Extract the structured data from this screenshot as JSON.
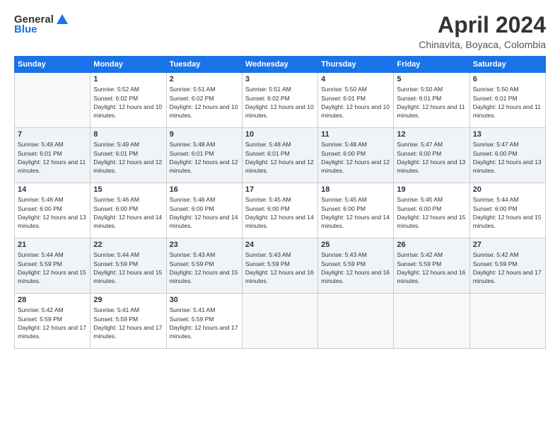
{
  "logo": {
    "general": "General",
    "blue": "Blue"
  },
  "title": "April 2024",
  "location": "Chinavita, Boyaca, Colombia",
  "weekdays": [
    "Sunday",
    "Monday",
    "Tuesday",
    "Wednesday",
    "Thursday",
    "Friday",
    "Saturday"
  ],
  "weeks": [
    [
      {
        "day": "",
        "sunrise": "",
        "sunset": "",
        "daylight": ""
      },
      {
        "day": "1",
        "sunrise": "Sunrise: 5:52 AM",
        "sunset": "Sunset: 6:02 PM",
        "daylight": "Daylight: 12 hours and 10 minutes."
      },
      {
        "day": "2",
        "sunrise": "Sunrise: 5:51 AM",
        "sunset": "Sunset: 6:02 PM",
        "daylight": "Daylight: 12 hours and 10 minutes."
      },
      {
        "day": "3",
        "sunrise": "Sunrise: 5:51 AM",
        "sunset": "Sunset: 6:02 PM",
        "daylight": "Daylight: 12 hours and 10 minutes."
      },
      {
        "day": "4",
        "sunrise": "Sunrise: 5:50 AM",
        "sunset": "Sunset: 6:01 PM",
        "daylight": "Daylight: 12 hours and 10 minutes."
      },
      {
        "day": "5",
        "sunrise": "Sunrise: 5:50 AM",
        "sunset": "Sunset: 6:01 PM",
        "daylight": "Daylight: 12 hours and 11 minutes."
      },
      {
        "day": "6",
        "sunrise": "Sunrise: 5:50 AM",
        "sunset": "Sunset: 6:01 PM",
        "daylight": "Daylight: 12 hours and 11 minutes."
      }
    ],
    [
      {
        "day": "7",
        "sunrise": "Sunrise: 5:49 AM",
        "sunset": "Sunset: 6:01 PM",
        "daylight": "Daylight: 12 hours and 11 minutes."
      },
      {
        "day": "8",
        "sunrise": "Sunrise: 5:49 AM",
        "sunset": "Sunset: 6:01 PM",
        "daylight": "Daylight: 12 hours and 12 minutes."
      },
      {
        "day": "9",
        "sunrise": "Sunrise: 5:48 AM",
        "sunset": "Sunset: 6:01 PM",
        "daylight": "Daylight: 12 hours and 12 minutes."
      },
      {
        "day": "10",
        "sunrise": "Sunrise: 5:48 AM",
        "sunset": "Sunset: 6:01 PM",
        "daylight": "Daylight: 12 hours and 12 minutes."
      },
      {
        "day": "11",
        "sunrise": "Sunrise: 5:48 AM",
        "sunset": "Sunset: 6:00 PM",
        "daylight": "Daylight: 12 hours and 12 minutes."
      },
      {
        "day": "12",
        "sunrise": "Sunrise: 5:47 AM",
        "sunset": "Sunset: 6:00 PM",
        "daylight": "Daylight: 12 hours and 13 minutes."
      },
      {
        "day": "13",
        "sunrise": "Sunrise: 5:47 AM",
        "sunset": "Sunset: 6:00 PM",
        "daylight": "Daylight: 12 hours and 13 minutes."
      }
    ],
    [
      {
        "day": "14",
        "sunrise": "Sunrise: 5:46 AM",
        "sunset": "Sunset: 6:00 PM",
        "daylight": "Daylight: 12 hours and 13 minutes."
      },
      {
        "day": "15",
        "sunrise": "Sunrise: 5:46 AM",
        "sunset": "Sunset: 6:00 PM",
        "daylight": "Daylight: 12 hours and 14 minutes."
      },
      {
        "day": "16",
        "sunrise": "Sunrise: 5:46 AM",
        "sunset": "Sunset: 6:00 PM",
        "daylight": "Daylight: 12 hours and 14 minutes."
      },
      {
        "day": "17",
        "sunrise": "Sunrise: 5:45 AM",
        "sunset": "Sunset: 6:00 PM",
        "daylight": "Daylight: 12 hours and 14 minutes."
      },
      {
        "day": "18",
        "sunrise": "Sunrise: 5:45 AM",
        "sunset": "Sunset: 6:00 PM",
        "daylight": "Daylight: 12 hours and 14 minutes."
      },
      {
        "day": "19",
        "sunrise": "Sunrise: 5:45 AM",
        "sunset": "Sunset: 6:00 PM",
        "daylight": "Daylight: 12 hours and 15 minutes."
      },
      {
        "day": "20",
        "sunrise": "Sunrise: 5:44 AM",
        "sunset": "Sunset: 6:00 PM",
        "daylight": "Daylight: 12 hours and 15 minutes."
      }
    ],
    [
      {
        "day": "21",
        "sunrise": "Sunrise: 5:44 AM",
        "sunset": "Sunset: 5:59 PM",
        "daylight": "Daylight: 12 hours and 15 minutes."
      },
      {
        "day": "22",
        "sunrise": "Sunrise: 5:44 AM",
        "sunset": "Sunset: 5:59 PM",
        "daylight": "Daylight: 12 hours and 15 minutes."
      },
      {
        "day": "23",
        "sunrise": "Sunrise: 5:43 AM",
        "sunset": "Sunset: 5:59 PM",
        "daylight": "Daylight: 12 hours and 15 minutes."
      },
      {
        "day": "24",
        "sunrise": "Sunrise: 5:43 AM",
        "sunset": "Sunset: 5:59 PM",
        "daylight": "Daylight: 12 hours and 16 minutes."
      },
      {
        "day": "25",
        "sunrise": "Sunrise: 5:43 AM",
        "sunset": "Sunset: 5:59 PM",
        "daylight": "Daylight: 12 hours and 16 minutes."
      },
      {
        "day": "26",
        "sunrise": "Sunrise: 5:42 AM",
        "sunset": "Sunset: 5:59 PM",
        "daylight": "Daylight: 12 hours and 16 minutes."
      },
      {
        "day": "27",
        "sunrise": "Sunrise: 5:42 AM",
        "sunset": "Sunset: 5:59 PM",
        "daylight": "Daylight: 12 hours and 17 minutes."
      }
    ],
    [
      {
        "day": "28",
        "sunrise": "Sunrise: 5:42 AM",
        "sunset": "Sunset: 5:59 PM",
        "daylight": "Daylight: 12 hours and 17 minutes."
      },
      {
        "day": "29",
        "sunrise": "Sunrise: 5:41 AM",
        "sunset": "Sunset: 5:59 PM",
        "daylight": "Daylight: 12 hours and 17 minutes."
      },
      {
        "day": "30",
        "sunrise": "Sunrise: 5:41 AM",
        "sunset": "Sunset: 5:59 PM",
        "daylight": "Daylight: 12 hours and 17 minutes."
      },
      {
        "day": "",
        "sunrise": "",
        "sunset": "",
        "daylight": ""
      },
      {
        "day": "",
        "sunrise": "",
        "sunset": "",
        "daylight": ""
      },
      {
        "day": "",
        "sunrise": "",
        "sunset": "",
        "daylight": ""
      },
      {
        "day": "",
        "sunrise": "",
        "sunset": "",
        "daylight": ""
      }
    ]
  ]
}
